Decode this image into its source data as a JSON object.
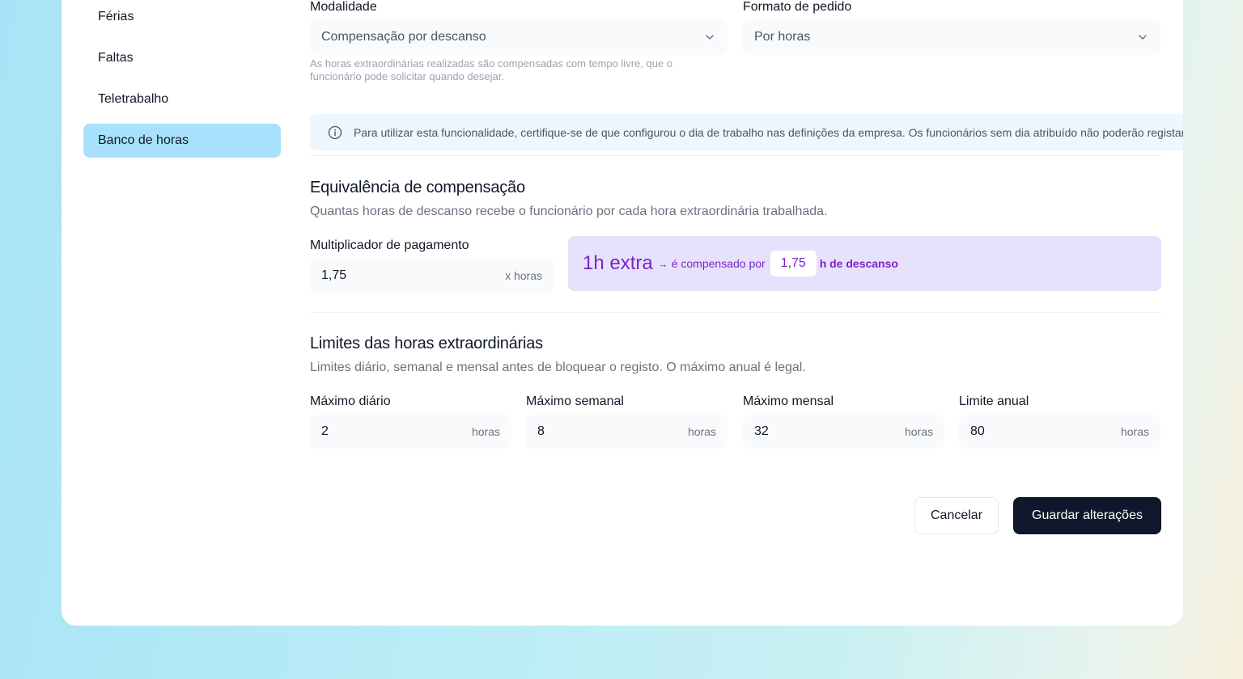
{
  "sidebar": {
    "items": [
      {
        "label": "Férias"
      },
      {
        "label": "Faltas"
      },
      {
        "label": "Teletrabalho"
      },
      {
        "label": "Banco de horas",
        "active": true
      }
    ]
  },
  "form": {
    "modalidade": {
      "label": "Modalidade",
      "value": "Compensação por descanso",
      "helper": "As horas extraordinárias realizadas são compensadas com tempo livre, que o funcionário pode solicitar quando desejar."
    },
    "formato": {
      "label": "Formato de pedido",
      "value": "Por horas"
    },
    "info_text": "Para utilizar esta funcionalidade, certifique-se de que configurou o dia de trabalho nas definições da empresa. Os funcionários sem dia atribuído não poderão registar horas."
  },
  "equivalencia": {
    "title": "Equivalência de compensação",
    "description": "Quantas horas de descanso recebe o funcionário por cada hora extraordinária trabalhada.",
    "multiplier_label": "Multiplicador de pagamento",
    "multiplier_value": "1,75",
    "multiplier_unit": "x horas",
    "preview": {
      "big": "1h extra",
      "arrow": "→",
      "text": "é compensado por",
      "value": "1,75",
      "suffix": "h de descanso"
    }
  },
  "limites": {
    "title": "Limites das horas extraordinárias",
    "description": "Limites diário, semanal e mensal antes de bloquear o registo. O máximo anual é legal.",
    "fields": [
      {
        "label": "Máximo diário",
        "value": "2",
        "unit": "horas"
      },
      {
        "label": "Máximo semanal",
        "value": "8",
        "unit": "horas"
      },
      {
        "label": "Máximo mensal",
        "value": "32",
        "unit": "horas"
      },
      {
        "label": "Limite anual",
        "value": "80",
        "unit": "horas"
      }
    ]
  },
  "actions": {
    "cancel": "Cancelar",
    "save": "Guardar alterações"
  },
  "colors": {
    "accent_active": "#a7e1fb",
    "primary_button": "#0f172a",
    "equiv_bg": "#e7e2fb",
    "equiv_text": "#7e22ce"
  },
  "icons": {
    "select_chevron": "chevron-down-icon",
    "info": "info-icon"
  }
}
